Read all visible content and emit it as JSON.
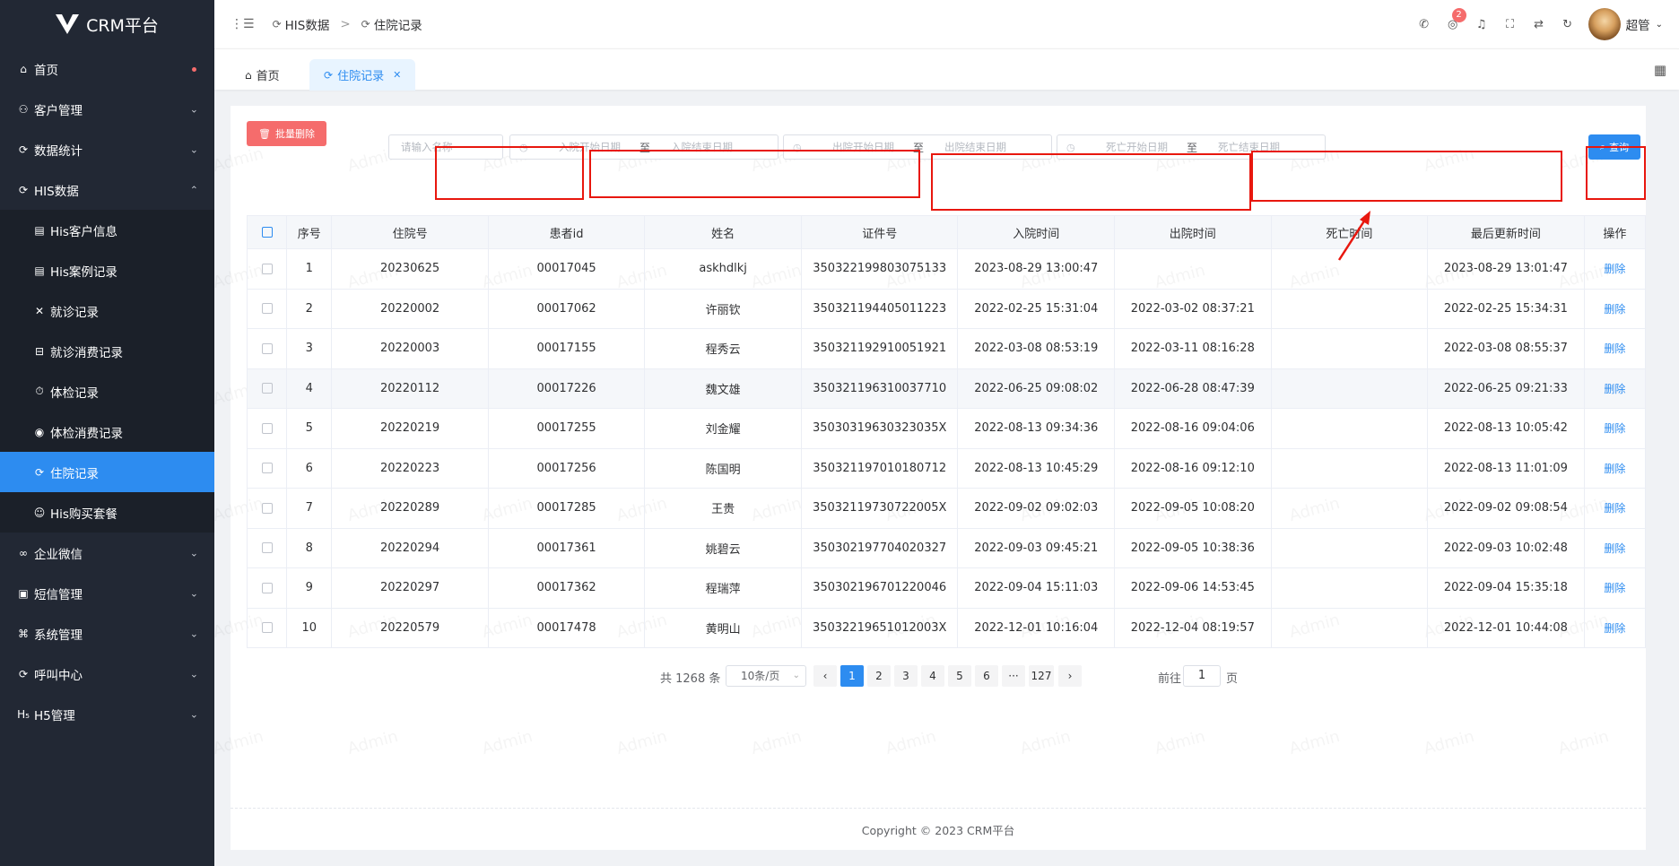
{
  "app": {
    "title": "CRM平台"
  },
  "sidebar": {
    "items": [
      {
        "label": "首页",
        "icon": "home-icon"
      },
      {
        "label": "客户管理",
        "icon": "user-icon"
      },
      {
        "label": "数据统计",
        "icon": "refresh-icon"
      },
      {
        "label": "HIS数据",
        "icon": "refresh-icon"
      },
      {
        "label": "His客户信息",
        "icon": "doc-icon"
      },
      {
        "label": "His案例记录",
        "icon": "doc-icon"
      },
      {
        "label": "就诊记录",
        "icon": "medical-icon"
      },
      {
        "label": "就诊消费记录",
        "icon": "box-icon"
      },
      {
        "label": "体检记录",
        "icon": "clock-icon"
      },
      {
        "label": "体检消费记录",
        "icon": "target-icon"
      },
      {
        "label": "住院记录",
        "icon": "refresh-icon"
      },
      {
        "label": "His购买套餐",
        "icon": "smile-icon"
      },
      {
        "label": "企业微信",
        "icon": "link-icon"
      },
      {
        "label": "短信管理",
        "icon": "chat-icon"
      },
      {
        "label": "系统管理",
        "icon": "command-icon"
      },
      {
        "label": "呼叫中心",
        "icon": "refresh-icon"
      },
      {
        "label": "H5管理",
        "icon": "h5-icon"
      }
    ]
  },
  "breadcrumb": {
    "first": "HIS数据",
    "second": "住院记录",
    "sep": ">"
  },
  "header": {
    "badge": "2",
    "username": "超管"
  },
  "tabs": {
    "home": "首页",
    "active": "住院记录"
  },
  "filters": {
    "name_placeholder": "请输入名称",
    "admit_start": "入院开始日期",
    "admit_end": "入院结束日期",
    "discharge_start": "出院开始日期",
    "discharge_end": "出院结束日期",
    "death_start": "死亡开始日期",
    "death_end": "死亡结束日期",
    "to": "至"
  },
  "buttons": {
    "batch_delete": "批量删除",
    "search": "查询"
  },
  "table": {
    "columns": [
      "序号",
      "住院号",
      "患者id",
      "姓名",
      "证件号",
      "入院时间",
      "出院时间",
      "死亡时间",
      "最后更新时间",
      "操作"
    ],
    "rows": [
      [
        "1",
        "20230625",
        "00017045",
        "askhdlkj",
        "350322199803075133",
        "2023-08-29 13:00:47",
        "",
        "",
        "2023-08-29 13:01:47",
        "删除"
      ],
      [
        "2",
        "20220002",
        "00017062",
        "许丽钦",
        "350321194405011223",
        "2022-02-25 15:31:04",
        "2022-03-02 08:37:21",
        "",
        "2022-02-25 15:34:31",
        "删除"
      ],
      [
        "3",
        "20220003",
        "00017155",
        "程秀云",
        "350321192910051921",
        "2022-03-08 08:53:19",
        "2022-03-11 08:16:28",
        "",
        "2022-03-08 08:55:37",
        "删除"
      ],
      [
        "4",
        "20220112",
        "00017226",
        "魏文雄",
        "350321196310037710",
        "2022-06-25 09:08:02",
        "2022-06-28 08:47:39",
        "",
        "2022-06-25 09:21:33",
        "删除"
      ],
      [
        "5",
        "20220219",
        "00017255",
        "刘金耀",
        "35030319630323035X",
        "2022-08-13 09:34:36",
        "2022-08-16 09:04:06",
        "",
        "2022-08-13 10:05:42",
        "删除"
      ],
      [
        "6",
        "20220223",
        "00017256",
        "陈国明",
        "350321197010180712",
        "2022-08-13 10:45:29",
        "2022-08-16 09:12:10",
        "",
        "2022-08-13 11:01:09",
        "删除"
      ],
      [
        "7",
        "20220289",
        "00017285",
        "王贵",
        "35032119730722005X",
        "2022-09-02 09:02:03",
        "2022-09-05 10:08:20",
        "",
        "2022-09-02 09:08:54",
        "删除"
      ],
      [
        "8",
        "20220294",
        "00017361",
        "姚碧云",
        "350302197704020327",
        "2022-09-03 09:45:21",
        "2022-09-05 10:38:36",
        "",
        "2022-09-03 10:02:48",
        "删除"
      ],
      [
        "9",
        "20220297",
        "00017362",
        "程瑞萍",
        "350302196701220046",
        "2022-09-04 15:11:03",
        "2022-09-06 14:53:45",
        "",
        "2022-09-04 15:35:18",
        "删除"
      ],
      [
        "10",
        "20220579",
        "00017478",
        "黄明山",
        "35032219651012003X",
        "2022-12-01 10:16:04",
        "2022-12-04 08:19:57",
        "",
        "2022-12-01 10:44:08",
        "删除"
      ]
    ]
  },
  "pagination": {
    "total": "共 1268 条",
    "page_size": "10条/页",
    "pages": [
      "1",
      "2",
      "3",
      "4",
      "5",
      "6",
      "···",
      "127"
    ],
    "goto": "前往",
    "goto_value": "1",
    "page_unit": "页"
  },
  "footer": "Copyright © 2023 CRM平台",
  "watermark": "Admin",
  "colors": {
    "primary": "#2d8cf0",
    "danger": "#f56c6c",
    "sidebar": "#222834",
    "annotation": "#e8170e"
  }
}
